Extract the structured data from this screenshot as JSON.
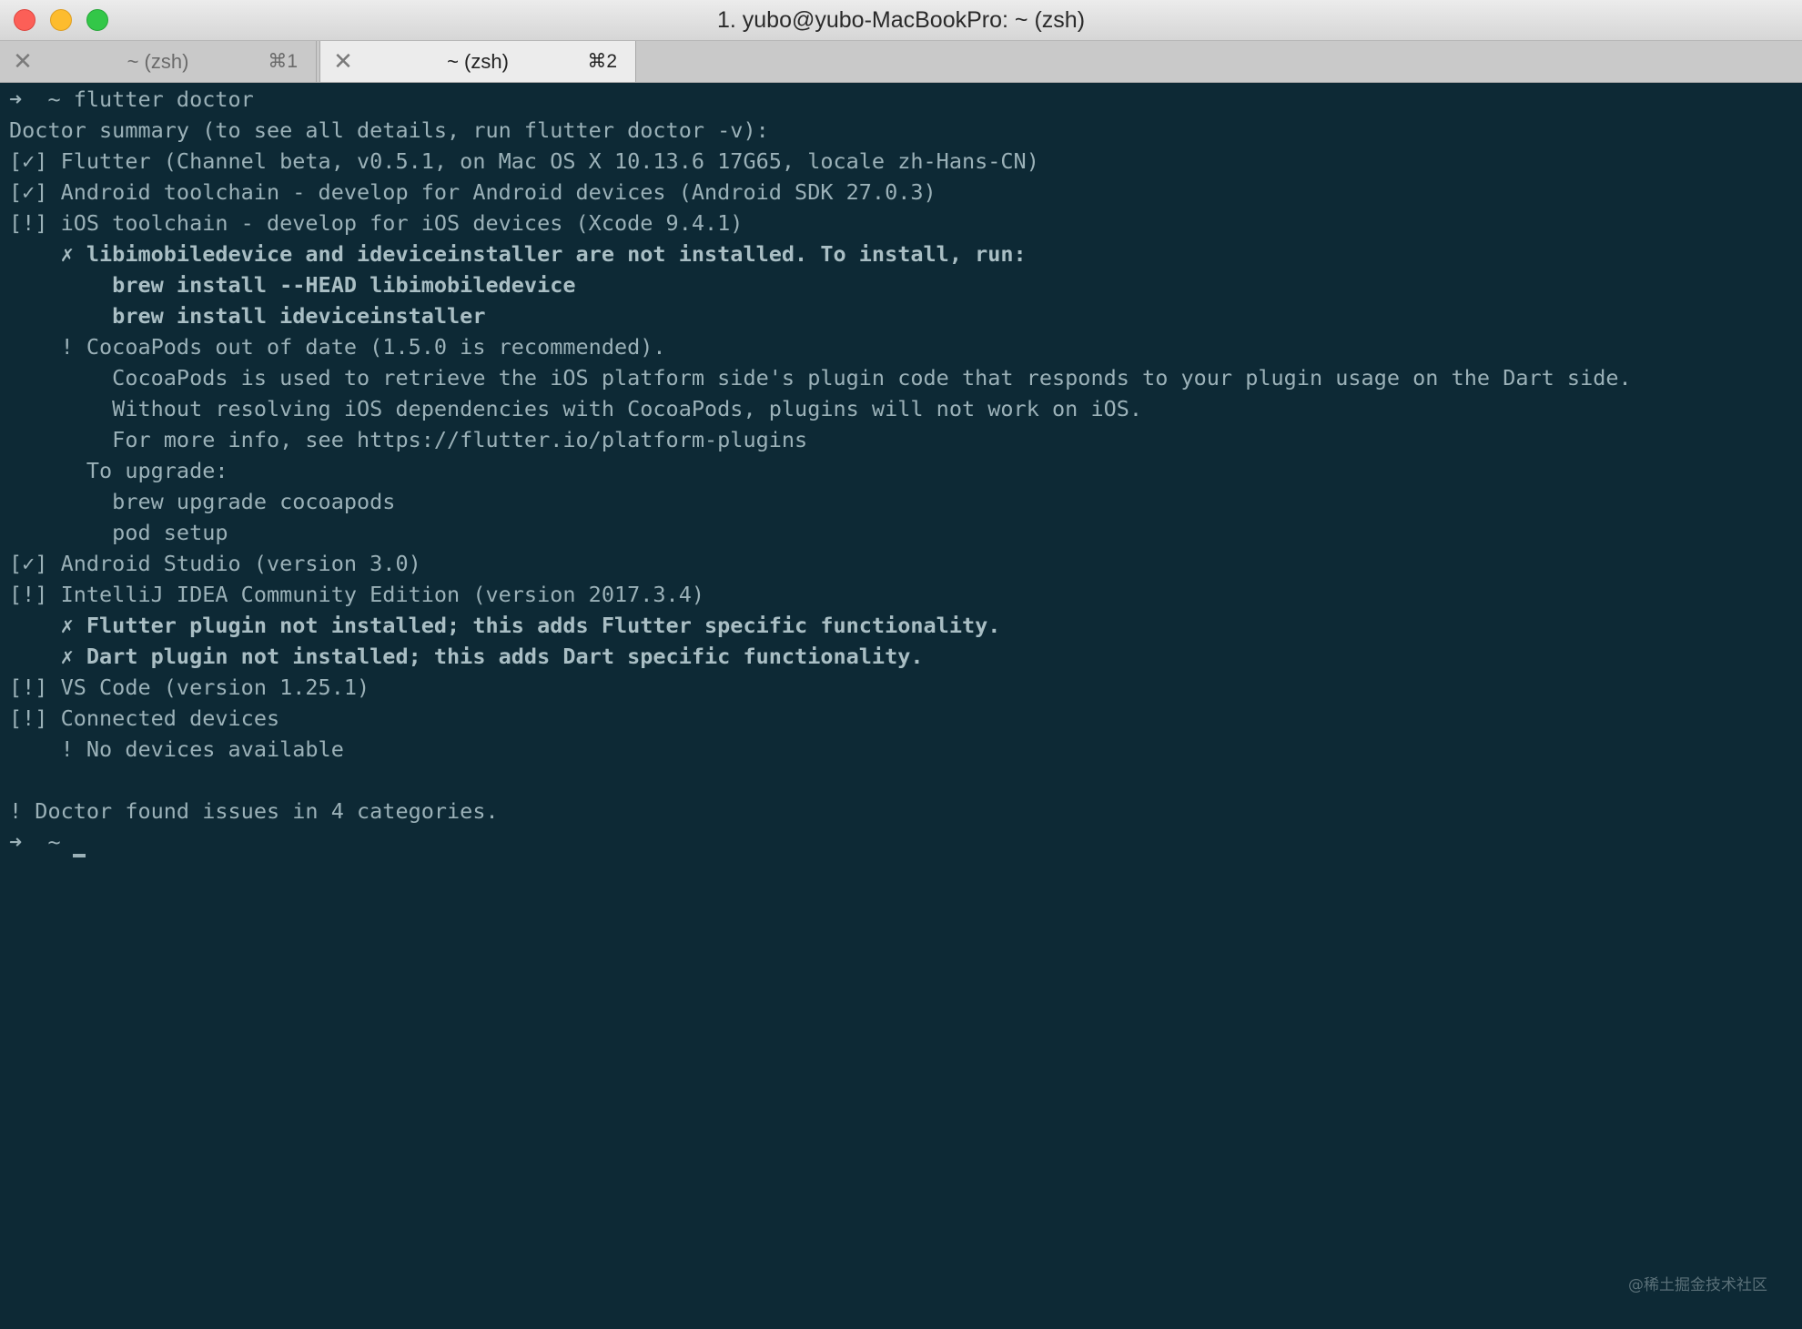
{
  "window": {
    "title": "1. yubo@yubo-MacBookPro: ~ (zsh)",
    "colors": {
      "background": "#0d2935",
      "text": "#9bb1b8",
      "close": "#fc5f57",
      "minimize": "#fdbc2e",
      "maximize": "#33c748"
    }
  },
  "tabs": [
    {
      "label": "~ (zsh)",
      "shortcut": "⌘1",
      "close": "✕",
      "active": false
    },
    {
      "label": "~ (zsh)",
      "shortcut": "⌘2",
      "close": "✕",
      "active": true
    }
  ],
  "terminal": {
    "lines": [
      "➜  ~ flutter doctor",
      "Doctor summary (to see all details, run flutter doctor -v):",
      "[✓] Flutter (Channel beta, v0.5.1, on Mac OS X 10.13.6 17G65, locale zh-Hans-CN)",
      "[✓] Android toolchain - develop for Android devices (Android SDK 27.0.3)",
      "[!] iOS toolchain - develop for iOS devices (Xcode 9.4.1)",
      "    ✗ libimobiledevice and ideviceinstaller are not installed. To install, run:",
      "        brew install --HEAD libimobiledevice",
      "        brew install ideviceinstaller",
      "    ! CocoaPods out of date (1.5.0 is recommended).",
      "        CocoaPods is used to retrieve the iOS platform side's plugin code that responds to your plugin usage on the Dart side.",
      "        Without resolving iOS dependencies with CocoaPods, plugins will not work on iOS.",
      "        For more info, see https://flutter.io/platform-plugins",
      "      To upgrade:",
      "        brew upgrade cocoapods",
      "        pod setup",
      "[✓] Android Studio (version 3.0)",
      "[!] IntelliJ IDEA Community Edition (version 2017.3.4)",
      "    ✗ Flutter plugin not installed; this adds Flutter specific functionality.",
      "    ✗ Dart plugin not installed; this adds Dart specific functionality.",
      "[!] VS Code (version 1.25.1)",
      "[!] Connected devices",
      "    ! No devices available",
      "! Doctor found issues in 4 categories.",
      "➜  ~"
    ]
  },
  "watermark": "@稀土掘金技术社区"
}
